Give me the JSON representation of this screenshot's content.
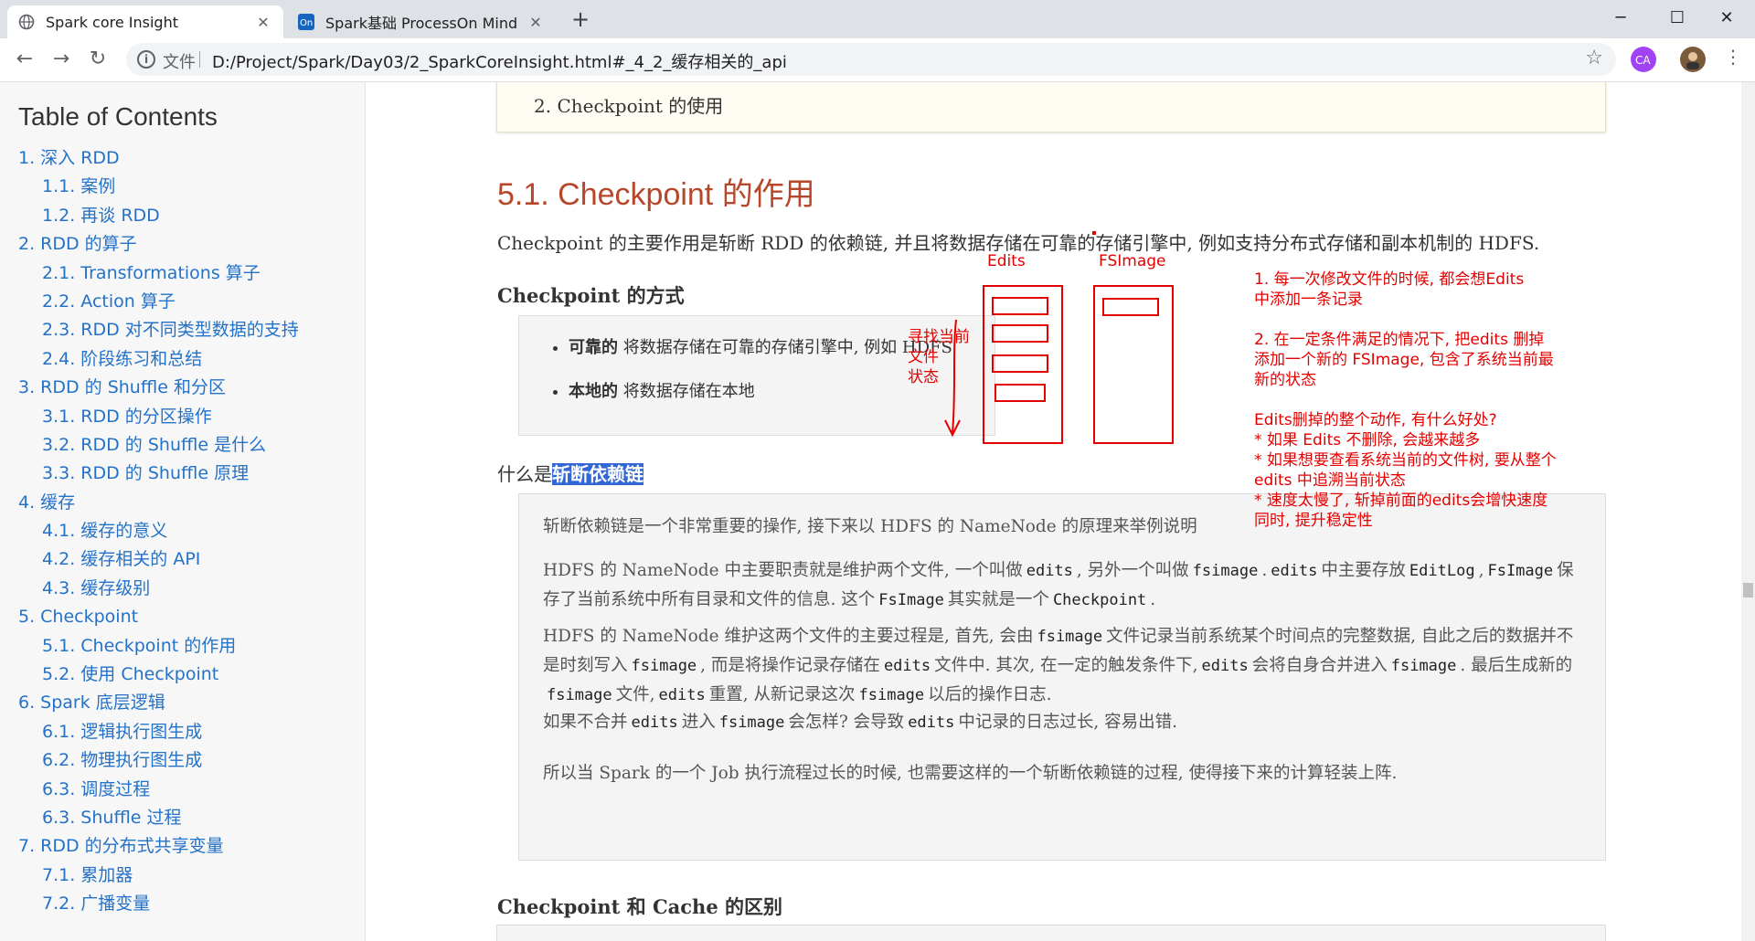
{
  "browser": {
    "tabs": [
      {
        "title": "Spark core Insight",
        "active": true
      },
      {
        "title": "Spark基础 ProcessOn Mind",
        "active": false
      }
    ],
    "new_tab": "+",
    "window_controls": {
      "minimize": "─",
      "maximize": "☐",
      "close": "✕"
    },
    "nav": {
      "back": "←",
      "forward": "→",
      "reload": "↻"
    },
    "address": {
      "prefix": "文件",
      "url": "D:/Project/Spark/Day03/2_SparkCoreInsight.html#_4_2_缓存相关的_api"
    },
    "icons": [
      "info-icon",
      "star-icon",
      "extension-icon",
      "profile-avatar",
      "menu-icon"
    ]
  },
  "toc": {
    "title": "Table of Contents",
    "items": [
      {
        "label": "1. 深入 RDD",
        "level": 1
      },
      {
        "label": "1.1. 案例",
        "level": 2
      },
      {
        "label": "1.2. 再谈 RDD",
        "level": 2
      },
      {
        "label": "2. RDD 的算子",
        "level": 1
      },
      {
        "label": "2.1. Transformations 算子",
        "level": 2
      },
      {
        "label": "2.2. Action 算子",
        "level": 2
      },
      {
        "label": "2.3. RDD 对不同类型数据的支持",
        "level": 2
      },
      {
        "label": "2.4. 阶段练习和总结",
        "level": 2
      },
      {
        "label": "3. RDD 的 Shuffle 和分区",
        "level": 1
      },
      {
        "label": "3.1. RDD 的分区操作",
        "level": 2
      },
      {
        "label": "3.2. RDD 的 Shuffle 是什么",
        "level": 2
      },
      {
        "label": "3.3. RDD 的 Shuffle 原理",
        "level": 2
      },
      {
        "label": "4. 缓存",
        "level": 1
      },
      {
        "label": "4.1. 缓存的意义",
        "level": 2
      },
      {
        "label": "4.2. 缓存相关的 API",
        "level": 2
      },
      {
        "label": "4.3. 缓存级别",
        "level": 2
      },
      {
        "label": "5. Checkpoint",
        "level": 1
      },
      {
        "label": "5.1. Checkpoint 的作用",
        "level": 2
      },
      {
        "label": "5.2. 使用 Checkpoint",
        "level": 2
      },
      {
        "label": "6. Spark 底层逻辑",
        "level": 1
      },
      {
        "label": "6.1. 逻辑执行图生成",
        "level": 2
      },
      {
        "label": "6.2. 物理执行图生成",
        "level": 2
      },
      {
        "label": "6.3. 调度过程",
        "level": 2
      },
      {
        "label": "6.3. Shuffle 过程",
        "level": 2
      },
      {
        "label": "7. RDD 的分布式共享变量",
        "level": 1
      },
      {
        "label": "7.1. 累加器",
        "level": 2
      },
      {
        "label": "7.2. 广播变量",
        "level": 2
      }
    ]
  },
  "content": {
    "top_item": "2. Checkpoint 的使用",
    "heading": "5.1. Checkpoint 的作用",
    "intro": "Checkpoint 的主要作用是斩断 RDD 的依赖链, 并且将数据存储在可靠的存储引擎中, 例如支持分布式存储和副本机制的 HDFS.",
    "way_heading": "Checkpoint 的方式",
    "ways": [
      {
        "bold": "可靠的",
        "rest": " 将数据存储在可靠的存储引擎中, 例如 HDFS"
      },
      {
        "bold": "本地的",
        "rest": " 将数据存储在本地"
      }
    ],
    "what_prefix": "什么是",
    "what_highlight": "斩断依赖链",
    "p1": "斩断依赖链是一个非常重要的操作, 接下来以 HDFS 的 NameNode 的原理来举例说明",
    "p2": {
      "a": "HDFS 的 NameNode 中主要职责就是维护两个文件, 一个叫做",
      "c1": "edits",
      "b": ", 另外一个叫做",
      "c2": "fsimage",
      "c": ".",
      "c3": "edits",
      "d": "中主要存放",
      "c4": "EditLog",
      "e": ",",
      "c5": "FsImage",
      "f": "保存了当前系统中所有目录和文件的信息. 这个",
      "c6": "FsImage",
      "g": "其实就是一个",
      "c7": "Checkpoint",
      "h": "."
    },
    "p3": {
      "a": "HDFS 的 NameNode 维护这两个文件的主要过程是, 首先, 会由",
      "c1": "fsimage",
      "b": "文件记录当前系统某个时间点的完整数据, 自此之后的数据并不是时刻写入",
      "c2": "fsimage",
      "c": ", 而是将操作记录存储在",
      "c3": "edits",
      "d": "文件中. 其次, 在一定的触发条件下,",
      "c4": "edits",
      "e": "会将自身合并进入",
      "c5": "fsimage",
      "f": ". 最后生成新的",
      "c6": "fsimage",
      "g": "文件,",
      "c7": "edits",
      "h": "重置, 从新记录这次",
      "c8": "fsimage",
      "i": "以后的操作日志."
    },
    "p4": {
      "a": "如果不合并",
      "c1": "edits",
      "b": "进入",
      "c2": "fsimage",
      "c": "会怎样? 会导致",
      "c3": "edits",
      "d": "中记录的日志过长, 容易出错."
    },
    "p5": "所以当 Spark 的一个 Job 执行流程过长的时候, 也需要这样的一个斩断依赖链的过程, 使得接下来的计算轻装上阵.",
    "next_heading": "Checkpoint 和 Cache 的区别"
  },
  "annotations": {
    "edits_label": "Edits",
    "fsimage_label": "FSImage",
    "search_note": [
      "寻找当前",
      "文件",
      "状态"
    ],
    "notes": [
      "1. 每一次修改文件的时候, 都会想Edits",
      "中添加一条记录",
      "",
      "2. 在一定条件满足的情况下, 把edits 删掉",
      "添加一个新的 FSImage, 包含了系统当前最",
      "新的状态",
      "",
      "Edits删掉的整个动作, 有什么好处?",
      "* 如果 Edits 不删除, 会越来越多",
      "* 如果想要查看系统当前的文件树, 要从整个",
      "edits 中追溯当前状态",
      "* 速度太慢了, 斩掉前面的edits会增快速度",
      "同时, 提升稳定性"
    ],
    "color": "#e50000"
  }
}
